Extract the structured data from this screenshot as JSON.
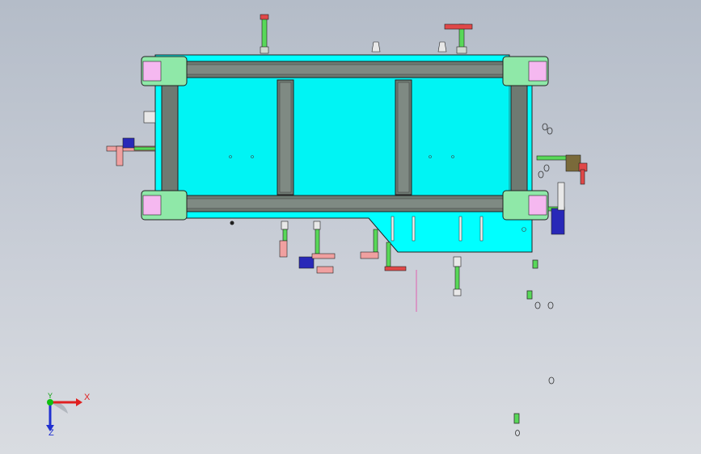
{
  "view": {
    "background_top": "#b4bcc8",
    "background_bottom": "#d9dce1",
    "colors": {
      "plate": "#00ffff",
      "frame_rail": "#6e7a72",
      "corner_block": "#8fe8a8",
      "corner_pad": "#f5b8f0",
      "clamp_arm": "#58d858",
      "clamp_red": "#e04848",
      "pin_pink": "#f0a0a0",
      "cylinder_blue": "#2828b8"
    }
  },
  "triad": {
    "x_label": "X",
    "y_label": "Y",
    "z_label": "Z",
    "x_color": "#e02020",
    "y_color": "#10a010",
    "z_color": "#2030d0"
  }
}
